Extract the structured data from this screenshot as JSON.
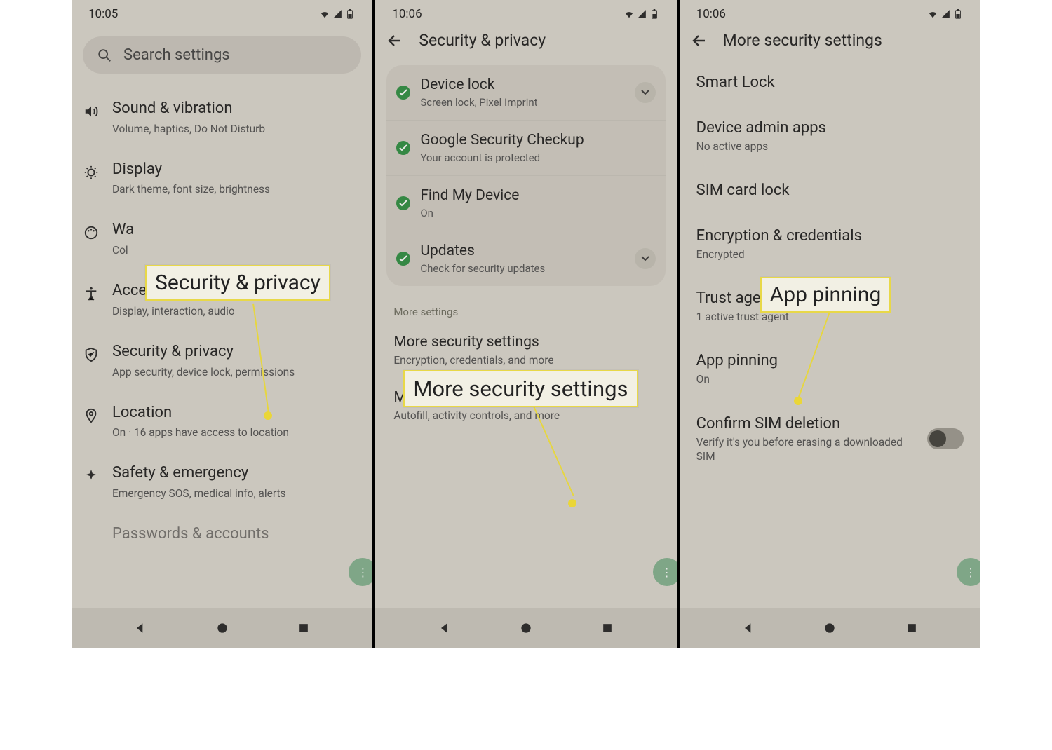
{
  "status": {
    "time1": "10:05",
    "time2": "10:06",
    "time3": "10:06"
  },
  "screen1": {
    "search_placeholder": "Search settings",
    "items": [
      {
        "title": "Sound & vibration",
        "sub": "Volume, haptics, Do Not Disturb"
      },
      {
        "title": "Display",
        "sub": "Dark theme, font size, brightness"
      },
      {
        "title": "Wa",
        "sub": "Col"
      },
      {
        "title": "Accessibility",
        "sub": "Display, interaction, audio"
      },
      {
        "title": "Security & privacy",
        "sub": "App security, device lock, permissions"
      },
      {
        "title": "Location",
        "sub": "On · 16 apps have access to location"
      },
      {
        "title": "Safety & emergency",
        "sub": "Emergency SOS, medical info, alerts"
      },
      {
        "title": "Passwords & accounts",
        "sub": ""
      }
    ]
  },
  "screen2": {
    "title": "Security & privacy",
    "cards": [
      {
        "title": "Device lock",
        "sub": "Screen lock, Pixel Imprint",
        "expand": true
      },
      {
        "title": "Google Security Checkup",
        "sub": "Your account is protected",
        "expand": false
      },
      {
        "title": "Find My Device",
        "sub": "On",
        "expand": false
      },
      {
        "title": "Updates",
        "sub": "Check for security updates",
        "expand": true
      }
    ],
    "section_label": "More settings",
    "more1_title": "More security settings",
    "more1_sub": "Encryption, credentials, and more",
    "more2_title": "More privacy settings",
    "more2_sub": "Autofill, activity controls, and more"
  },
  "screen3": {
    "title": "More security settings",
    "items": [
      {
        "title": "Smart Lock",
        "sub": ""
      },
      {
        "title": "Device admin apps",
        "sub": "No active apps"
      },
      {
        "title": "SIM card lock",
        "sub": ""
      },
      {
        "title": "Encryption & credentials",
        "sub": "Encrypted"
      },
      {
        "title": "Trust agents",
        "sub": "1 active trust agent"
      },
      {
        "title": "App pinning",
        "sub": "On"
      },
      {
        "title": "Confirm SIM deletion",
        "sub": "Verify it's you before erasing a downloaded SIM"
      }
    ]
  },
  "callouts": {
    "c1": "Security & privacy",
    "c2": "More security settings",
    "c3": "App pinning"
  }
}
